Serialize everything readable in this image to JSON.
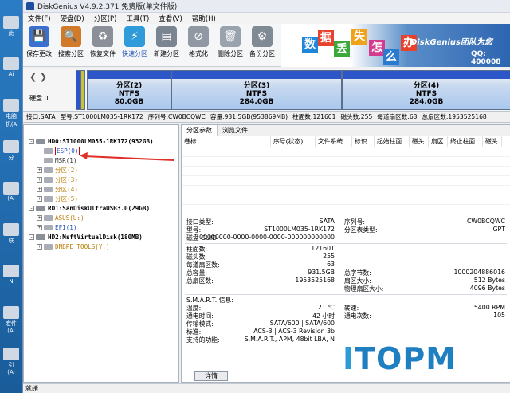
{
  "app": {
    "title": "DiskGenius V4.9.2.371 免费版(单文件版)"
  },
  "menu": [
    "文件(F)",
    "硬盘(D)",
    "分区(P)",
    "工具(T)",
    "查看(V)",
    "帮助(H)"
  ],
  "toolbar": [
    {
      "label": "保存更改",
      "icon": "save-icon",
      "color": "#3b6fd0"
    },
    {
      "label": "搜索分区",
      "icon": "search-icon",
      "color": "#d07a2a"
    },
    {
      "label": "恢复文件",
      "icon": "recover-icon",
      "color": "#8a8f98"
    },
    {
      "label": "快速分区",
      "icon": "quick-partition-icon",
      "color": "#2f9bd8"
    },
    {
      "label": "新建分区",
      "icon": "new-partition-icon",
      "color": "#7b8591"
    },
    {
      "label": "格式化",
      "icon": "format-icon",
      "color": "#8f98a3"
    },
    {
      "label": "删除分区",
      "icon": "delete-icon",
      "color": "#9aa3ad"
    },
    {
      "label": "备份分区",
      "icon": "backup-icon",
      "color": "#7f8a95"
    }
  ],
  "banner": {
    "chars": [
      "数",
      "据",
      "丢",
      "失",
      "怎",
      "么",
      "办"
    ],
    "brand": "DiskGenius团队为您",
    "qq": "QQ: 400008"
  },
  "diskmap": {
    "disk_label": "硬盘 0",
    "partitions": [
      {
        "name": "分区(2)",
        "fs": "NTFS",
        "size": "80.0GB"
      },
      {
        "name": "分区(3)",
        "fs": "NTFS",
        "size": "284.0GB"
      },
      {
        "name": "分区(4)",
        "fs": "NTFS",
        "size": "284.0GB"
      }
    ]
  },
  "infobar": [
    "接口:SATA",
    "型号:ST1000LM035-1RK172",
    "序列号:CW0BCQWC",
    "容量:931.5GB(953869MB)",
    "柱面数:121601",
    "磁头数:255",
    "每道扇区数:63",
    "总扇区数:1953525168"
  ],
  "tree": [
    {
      "text": "HD0:ST1000LM035-1RK172(932GB)",
      "level": 0,
      "pm": "-",
      "kind": "disk",
      "color": "#000"
    },
    {
      "text": "ESP(0)",
      "level": 1,
      "pm": "",
      "kind": "part",
      "color": "#2553b8",
      "selected": true
    },
    {
      "text": "MSR(1)",
      "level": 1,
      "pm": "",
      "kind": "part",
      "color": "#333"
    },
    {
      "text": "分区(2)",
      "level": 1,
      "pm": "+",
      "kind": "part",
      "color": "#b87a00"
    },
    {
      "text": "分区(3)",
      "level": 1,
      "pm": "+",
      "kind": "part",
      "color": "#b87a00"
    },
    {
      "text": "分区(4)",
      "level": 1,
      "pm": "+",
      "kind": "part",
      "color": "#b87a00"
    },
    {
      "text": "分区(5)",
      "level": 1,
      "pm": "+",
      "kind": "part",
      "color": "#b87a00"
    },
    {
      "text": "RD1:SanDiskUltraUSB3.0(29GB)",
      "level": 0,
      "pm": "-",
      "kind": "disk",
      "color": "#000"
    },
    {
      "text": "ASUS(U:)",
      "level": 1,
      "pm": "+",
      "kind": "part",
      "color": "#b87a00"
    },
    {
      "text": "EFI(1)",
      "level": 1,
      "pm": "+",
      "kind": "part",
      "color": "#2553b8"
    },
    {
      "text": "HD2:MsftVirtualDisk(180MB)",
      "level": 0,
      "pm": "-",
      "kind": "disk",
      "color": "#000"
    },
    {
      "text": "DNBPE_TOOLS(Y:)",
      "level": 1,
      "pm": "+",
      "kind": "part",
      "color": "#b87a00"
    }
  ],
  "tabs": [
    "分区参数",
    "浏览文件"
  ],
  "columns": [
    "卷标",
    "序号(状态)",
    "文件系统",
    "标识",
    "起始柱面",
    "磁头",
    "扇区",
    "终止柱面",
    "磁头"
  ],
  "details": {
    "block1": [
      {
        "l": "接口类型:",
        "v": "SATA",
        "l2": "序列号:",
        "v2": "CW0BCQWC"
      },
      {
        "l": "型号:",
        "v": "ST1000LM035-1RK172",
        "l2": "分区表类型:",
        "v2": "GPT"
      },
      {
        "l": "磁盘 GUID:",
        "v": "00000000-0000-0000-0000-000000000000",
        "l2": "",
        "v2": ""
      }
    ],
    "block2": [
      {
        "l": "柱面数:",
        "v": "121601",
        "l2": "",
        "v2": ""
      },
      {
        "l": "磁头数:",
        "v": "255",
        "l2": "",
        "v2": ""
      },
      {
        "l": "每道扇区数:",
        "v": "63",
        "l2": "",
        "v2": ""
      },
      {
        "l": "总容量:",
        "v": "931.5GB",
        "l2": "总字节数:",
        "v2": "1000204886016"
      },
      {
        "l": "总扇区数:",
        "v": "1953525168",
        "l2": "扇区大小:",
        "v2": "512 Bytes"
      },
      {
        "l": "",
        "v": "",
        "l2": "物理扇区大小:",
        "v2": "4096 Bytes"
      }
    ],
    "block3": [
      {
        "l": "S.M.A.R.T. 信息:",
        "v": "",
        "l2": "",
        "v2": ""
      },
      {
        "l": "温度:",
        "v": "21 ℃",
        "l2": "转速:",
        "v2": "5400 RPM"
      },
      {
        "l": "通电时间:",
        "v": "42 小时",
        "l2": "通电次数:",
        "v2": "105"
      },
      {
        "l": "传输模式:",
        "v": "SATA/600 | SATA/600",
        "l2": "",
        "v2": ""
      },
      {
        "l": "标准:",
        "v": "ACS-3 | ACS-3 Revision 3b",
        "l2": "",
        "v2": ""
      },
      {
        "l": "支持的功能:",
        "v": "S.M.A.R.T., APM, 48bit LBA, N",
        "l2": "",
        "v2": ""
      }
    ],
    "detail_button": "详情"
  },
  "status": "就绪",
  "watermark": {
    "a": "I",
    "b": "TOPM"
  },
  "desktop_icons": [
    "此",
    "Ai",
    "电脑\n机(A",
    "分",
    "(Al",
    "联",
    "N",
    "宏件\n(Al",
    "引\n(Al"
  ]
}
